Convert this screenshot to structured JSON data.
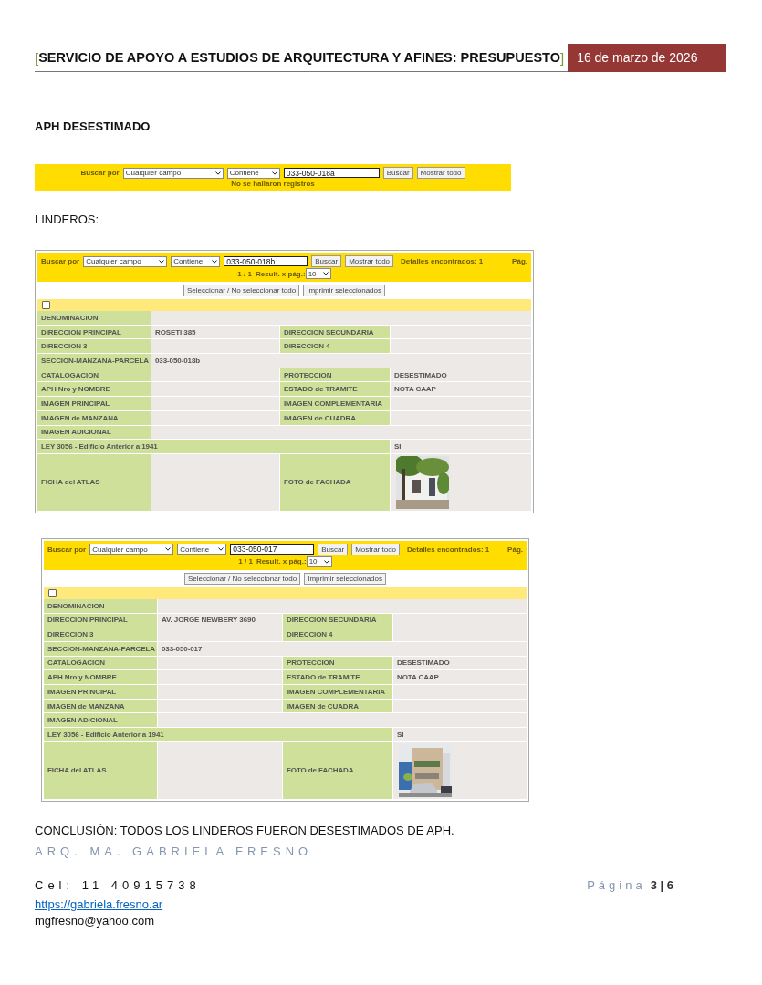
{
  "header": {
    "open_bracket": "[",
    "title": "SERVICIO DE APOYO A ESTUDIOS DE ARQUITECTURA Y AFINES: PRESUPUESTO",
    "close_bracket": "]",
    "date": "16 de marzo de 2026"
  },
  "section_title": "APH DESESTIMADO",
  "first_search": {
    "label": "Buscar por",
    "field": "Cualquier campo",
    "operator": "Contiene",
    "query": "033-050-018a",
    "search_button": "Buscar",
    "show_all_button": "Mostrar todo",
    "message": "No se hallaron registros"
  },
  "linderos_label": "LINDEROS:",
  "records": [
    {
      "search": {
        "label": "Buscar por",
        "field": "Cualquier campo",
        "operator": "Contiene",
        "query": "033-050-018b",
        "search_button": "Buscar",
        "show_all_button": "Mostrar todo",
        "found": "Detalles encontrados: 1",
        "page_label": "Pág."
      },
      "pager": "1 / 1",
      "per_page_label": "Result. x pág.:",
      "per_page": "10",
      "select_all_button": "Seleccionar / No seleccionar todo",
      "print_button": "Imprimir seleccionados",
      "checked": false,
      "rows": [
        {
          "kind": "single",
          "label": "DENOMINACION"
        },
        {
          "kind": "pair",
          "label": "DIRECCION PRINCIPAL",
          "value": "ROSETI 385",
          "label2": "DIRECCION SECUNDARIA"
        },
        {
          "kind": "pair",
          "label": "DIRECCION 3",
          "label2": "DIRECCION 4"
        },
        {
          "kind": "single",
          "label": "SECCION-MANZANA-PARCELA",
          "value": "033-050-018b"
        },
        {
          "kind": "pair",
          "label": "CATALOGACION",
          "label2": "PROTECCION",
          "value2": "DESESTIMADO"
        },
        {
          "kind": "pair",
          "label": "APH Nro y NOMBRE",
          "label2": "ESTADO de TRAMITE",
          "value2": "NOTA CAAP"
        },
        {
          "kind": "pair",
          "label": "IMAGEN PRINCIPAL",
          "label2": "IMAGEN COMPLEMENTARIA"
        },
        {
          "kind": "pair",
          "label": "IMAGEN de MANZANA",
          "label2": "IMAGEN de CUADRA"
        },
        {
          "kind": "single",
          "label": "IMAGEN ADICIONAL"
        },
        {
          "kind": "wide",
          "label": "LEY 3056 - Edificio Anterior a 1941",
          "value": "SI"
        },
        {
          "label": "FICHA del ATLAS",
          "label2": "FOTO de FACHADA"
        }
      ]
    },
    {
      "search": {
        "label": "Buscar por",
        "field": "Cualquier campo",
        "operator": "Contiene",
        "query": "033-050-017",
        "search_button": "Buscar",
        "show_all_button": "Mostrar todo",
        "found": "Detalles encontrados: 1",
        "page_label": "Pág."
      },
      "pager": "1 / 1",
      "per_page_label": "Result. x pág.:",
      "per_page": "10",
      "select_all_button": "Seleccionar / No seleccionar todo",
      "print_button": "Imprimir seleccionados",
      "checked": false,
      "rows": [
        {
          "kind": "single",
          "label": "DENOMINACION"
        },
        {
          "kind": "pair",
          "label": "DIRECCION PRINCIPAL",
          "value": "AV. JORGE NEWBERY 3690",
          "label2": "DIRECCION SECUNDARIA"
        },
        {
          "kind": "pair",
          "label": "DIRECCION 3",
          "label2": "DIRECCION 4"
        },
        {
          "kind": "single",
          "label": "SECCION-MANZANA-PARCELA",
          "value": "033-050-017"
        },
        {
          "kind": "pair",
          "label": "CATALOGACION",
          "label2": "PROTECCION",
          "value2": "DESESTIMADO"
        },
        {
          "kind": "pair",
          "label": "APH Nro y NOMBRE",
          "label2": "ESTADO de TRAMITE",
          "value2": "NOTA CAAP"
        },
        {
          "kind": "pair",
          "label": "IMAGEN PRINCIPAL",
          "label2": "IMAGEN COMPLEMENTARIA"
        },
        {
          "kind": "pair",
          "label": "IMAGEN de MANZANA",
          "label2": "IMAGEN de CUADRA"
        },
        {
          "kind": "single",
          "label": "IMAGEN ADICIONAL"
        },
        {
          "kind": "wide",
          "label": "LEY 3056 - Edificio Anterior a 1941",
          "value": "SI"
        },
        {
          "label": "FICHA del ATLAS",
          "label2": "FOTO de FACHADA"
        }
      ]
    }
  ],
  "conclusion": "CONCLUSIÓN: TODOS LOS LINDEROS FUERON DESESTIMADOS DE APH.",
  "footer": {
    "author": "ARQ. MA. GABRIELA FRESNO",
    "phone": "Cel: 11 40915738",
    "page_label": "Página",
    "page_number": "3 | 6",
    "website": "https://gabriela.fresno.ar",
    "email": "mgfresno@yahoo.com"
  }
}
